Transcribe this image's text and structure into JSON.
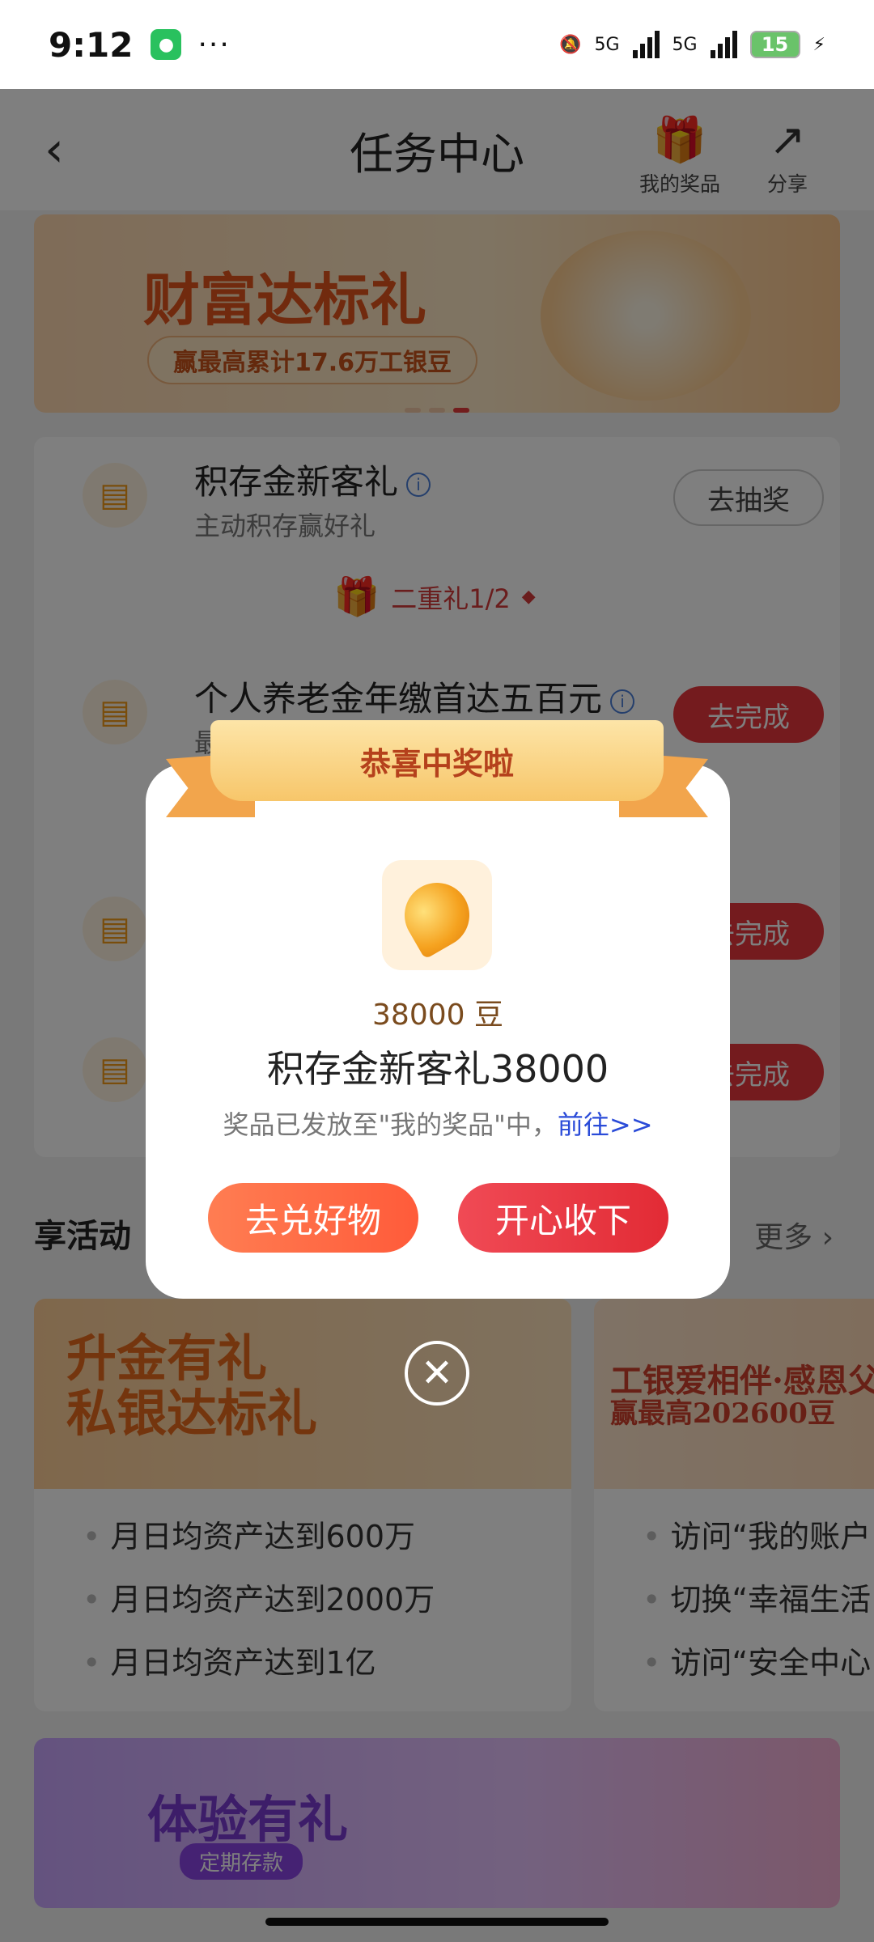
{
  "status": {
    "time": "9:12",
    "battery": "15",
    "net1": "5G",
    "net2": "5G"
  },
  "header": {
    "title": "任务中心",
    "prizes_label": "我的奖品",
    "share_label": "分享"
  },
  "banner": {
    "title": "财富达标礼",
    "subtitle": "赢最高累计17.6万工银豆"
  },
  "tasks": [
    {
      "name": "积存金新客礼",
      "desc": "主动积存赢好礼",
      "button": "去抽奖"
    },
    {
      "name": "个人养老金年缴首达五百元",
      "desc": "最",
      "button": "去完成"
    },
    {
      "name": "",
      "desc": "",
      "button": "去完成"
    },
    {
      "name": "",
      "desc": "",
      "button": "去完成"
    }
  ],
  "double_gift": "二重礼1/2",
  "section": {
    "title": "享活动",
    "more": "更多"
  },
  "activity1": {
    "title_line1": "升金有礼",
    "title_line2": "私银达标礼",
    "items": [
      "月日均资产达到600万",
      "月日均资产达到2000万",
      "月日均资产达到1亿"
    ]
  },
  "activity2": {
    "title": "工银爱相伴·感恩父母",
    "sub": "赢最高202600豆",
    "items": [
      "访问“我的账户",
      "切换“幸福生活",
      "访问“安全中心"
    ]
  },
  "bottom_banner": {
    "title": "体验有礼",
    "tag": "定期存款"
  },
  "dialog": {
    "ribbon": "恭喜中奖啦",
    "amount": "38000 豆",
    "name": "积存金新客礼38000",
    "note": "奖品已发放至\"我的奖品\"中，",
    "note_link": "前往>>",
    "btn_left": "去兑好物",
    "btn_right": "开心收下"
  }
}
